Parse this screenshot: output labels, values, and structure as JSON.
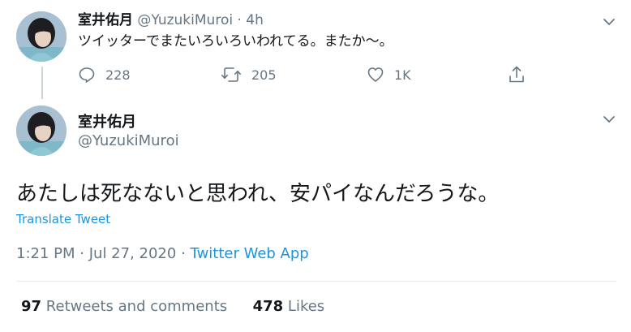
{
  "tweet1": {
    "display_name": "室井佑月",
    "handle": "@YuzukiMuroi",
    "separator": "·",
    "time": "4h",
    "text": "ツイッターでまたいろいろいわれてる。またか〜。",
    "replies": "228",
    "retweets": "205",
    "likes": "1K",
    "icons": [
      "reply-icon",
      "retweet-icon",
      "like-icon",
      "share-icon",
      "chevron-down-icon"
    ]
  },
  "tweet2": {
    "display_name": "室井佑月",
    "handle": "@YuzukiMuroi",
    "text": "あたしは死なないと思われ、安パイなんだろうな。",
    "translate_label": "Translate Tweet",
    "time": "1:21 PM",
    "date": "Jul 27, 2020",
    "separator": "·",
    "source": "Twitter Web App",
    "retweets_count": "97",
    "retweets_label": "Retweets and comments",
    "likes_count": "478",
    "likes_label": "Likes"
  },
  "colors": {
    "link": "#1b95e0",
    "muted": "#657786",
    "text": "#14171a",
    "divider": "#e6ecf0"
  }
}
